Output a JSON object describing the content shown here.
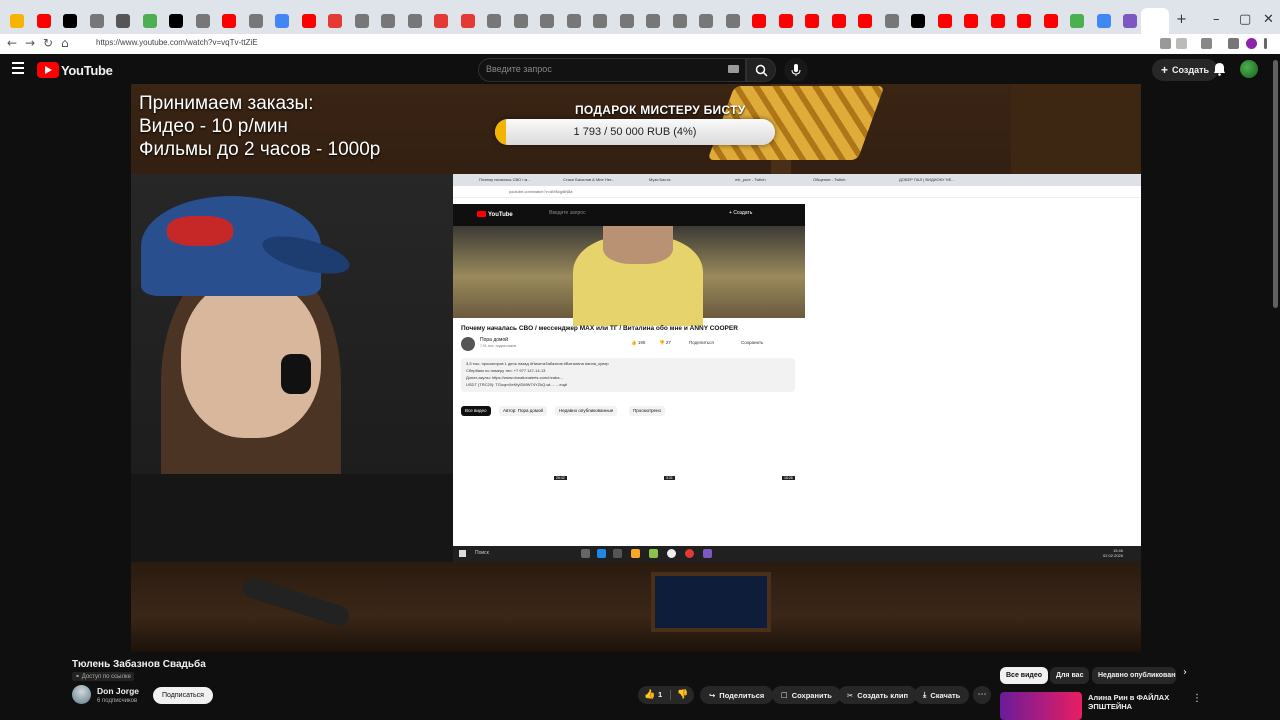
{
  "browser": {
    "url": "https://www.youtube.com/watch?v=vqTv-ttZiE",
    "tab_colors": [
      "#f4b400",
      "#ff0000",
      "#000000",
      "#777777",
      "#555555",
      "#4caf50",
      "#000000",
      "#777777",
      "#ff0000",
      "#777777",
      "#4285f4",
      "#ff0000",
      "#e53935",
      "#777777",
      "#777777",
      "#777777",
      "#e53935",
      "#e53935",
      "#777777",
      "#777777",
      "#777777",
      "#777777",
      "#777777",
      "#777777",
      "#777777",
      "#777777",
      "#777777",
      "#777777",
      "#ff0000",
      "#ff0000",
      "#ff0000",
      "#ff0000",
      "#ff0000",
      "#777777",
      "#000000",
      "#ff0000",
      "#ff0000",
      "#ff0000",
      "#ff0000",
      "#ff0000",
      "#4caf50",
      "#4285f4",
      "#7e57c2"
    ]
  },
  "youtube": {
    "logo_text": "YouTube",
    "search_placeholder": "Введите запрос",
    "create_label": "Создать"
  },
  "video": {
    "overlay_lines": [
      "Принимаем заказы:",
      "Видео - 10 р/мин",
      "Фильмы до 2 часов - 1000р"
    ],
    "gift_title": "ПОДАРОК МИСТЕРУ БИСТУ",
    "gift_progress_label": "1 793 / 50 000 RUB (4%)",
    "gift_progress_fraction": 0.04,
    "shared_screen": {
      "tabs": [
        "Почему началась СВО / м...",
        "Стасе Басилов & Мне Нет...",
        "Музи Баста",
        "mir_pure - Twitch",
        "Общение - Twitch",
        "ДОБЕР ПАЛ | ВИДИОКУ НЕ..."
      ],
      "url": "youtube.com/watch?v=dMNqp8N8a",
      "search_placeholder": "Введите запрос",
      "create_label": "Создать",
      "video_title": "Почему началась СВО / мессенджер MAX или ТГ / Виталина обо мне и ANNY COOPER",
      "channel_name": "Пора домой",
      "channel_subs": "7,91 тыс. подписчиков",
      "likes": "195",
      "dislikes": "27",
      "share": "Поделиться",
      "save": "Сохранить",
      "description_lines": [
        "3,5 тыс. просмотров  1 день назад  #НикитаЗабазнов #Виталина #анна_купер",
        "Сбербанк по номеру тел: +7 977 147-14-13",
        "Донат-акулы: https://www.donationalerts.com/r/zaba...",
        "USDT (TRC20): TGuqmXeKfyIDMW74YZkQ-wi-...  ...ещё"
      ],
      "chips": [
        "Все видео",
        "Автор: Пора домой",
        "Недавно опубликованные",
        "Просмотрено"
      ],
      "durations": [
        "26:42",
        "3:31",
        "16:26"
      ],
      "taskbar_search": "Поиск",
      "clock_time": "15:46",
      "clock_date": "02.02.2026"
    }
  },
  "below": {
    "title": "Тюлень Забазнов Свадьба",
    "access": "Доступ по ссылке",
    "channel_name": "Don Jorge",
    "channel_subs": "6 подписчиков",
    "subscribe_label": "Подписаться",
    "like_count": "1",
    "share_label": "Поделиться",
    "save_label": "Сохранить",
    "clip_label": "Создать клип",
    "download_label": "Скачать"
  },
  "sidebar": {
    "chips": [
      "Все видео",
      "Для вас",
      "Недавно опубликованные"
    ],
    "rec_title": "Алина Рин в ФАЙЛАХ ЭПШТЕЙНА"
  }
}
